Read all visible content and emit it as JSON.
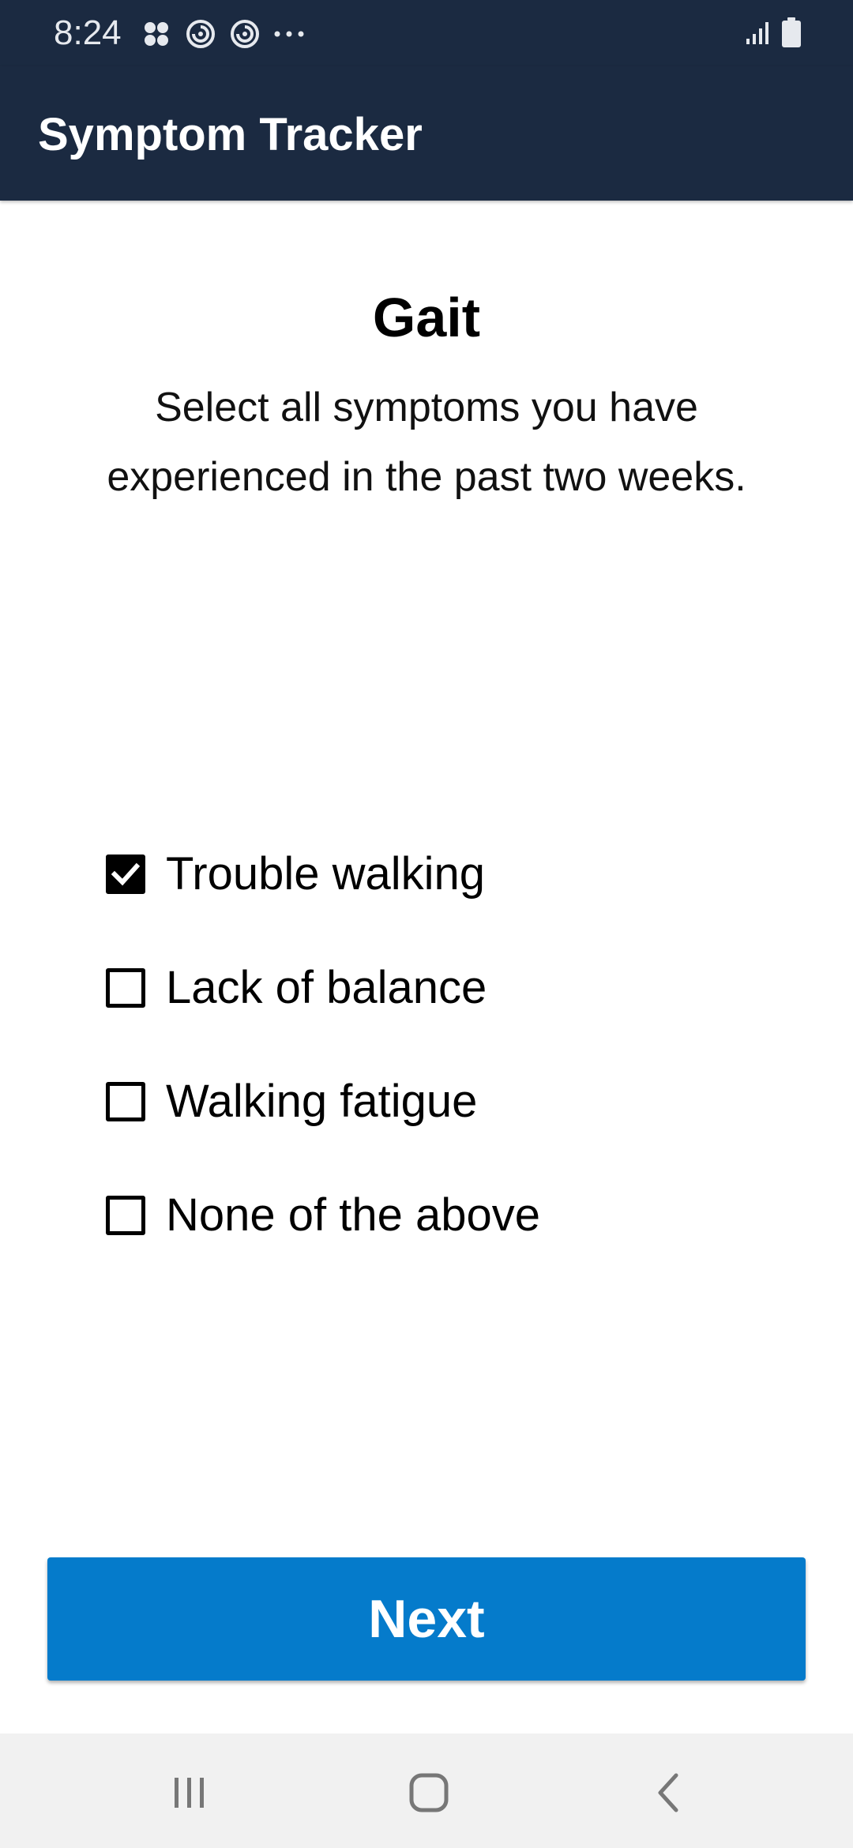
{
  "status_bar": {
    "time": "8:24",
    "left_icons": [
      "apps-grid-icon",
      "notification-swirl-icon",
      "notification-swirl-icon",
      "more-dots-icon"
    ],
    "right_icons": [
      "signal-icon",
      "battery-icon"
    ]
  },
  "app_bar": {
    "title": "Symptom Tracker",
    "background": "#1b2a41"
  },
  "question": {
    "title": "Gait",
    "subtitle": "Select all symptoms you have experienced in the past two weeks."
  },
  "options": [
    {
      "label": "Trouble walking",
      "checked": true
    },
    {
      "label": "Lack of balance",
      "checked": false
    },
    {
      "label": "Walking fatigue",
      "checked": false
    },
    {
      "label": "None of the above",
      "checked": false
    }
  ],
  "next_button": {
    "label": "Next",
    "color": "#057bcb"
  },
  "nav_bar": {
    "icons": [
      "recent-apps-icon",
      "home-icon",
      "back-icon"
    ]
  }
}
